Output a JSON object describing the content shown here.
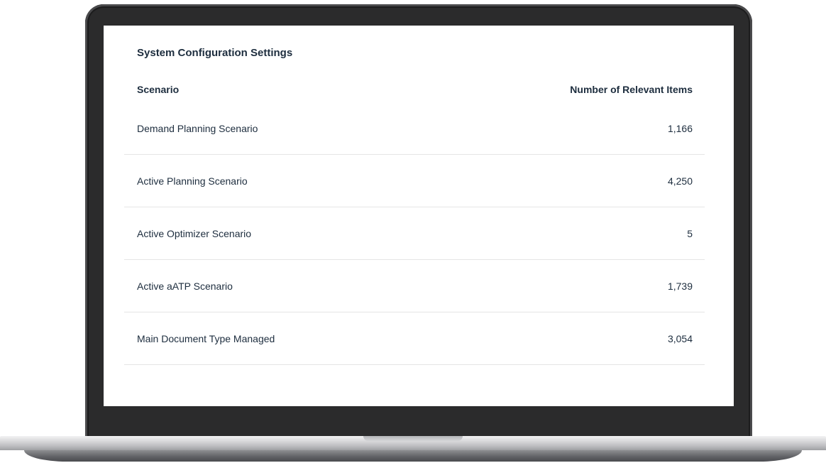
{
  "card": {
    "title": "System Configuration Settings",
    "columns": {
      "scenario": "Scenario",
      "count": "Number of Relevant Items"
    },
    "rows": [
      {
        "scenario": "Demand Planning Scenario",
        "count": "1,166"
      },
      {
        "scenario": "Active Planning Scenario",
        "count": "4,250"
      },
      {
        "scenario": "Active Optimizer Scenario",
        "count": "5"
      },
      {
        "scenario": "Active aATP Scenario",
        "count": "1,739"
      },
      {
        "scenario": "Main Document Type Managed",
        "count": "3,054"
      }
    ]
  },
  "colors": {
    "text": "#1d2d3e",
    "divider": "#e5e5e5",
    "bezel": "#2b2b2c",
    "screen": "#ffffff"
  }
}
